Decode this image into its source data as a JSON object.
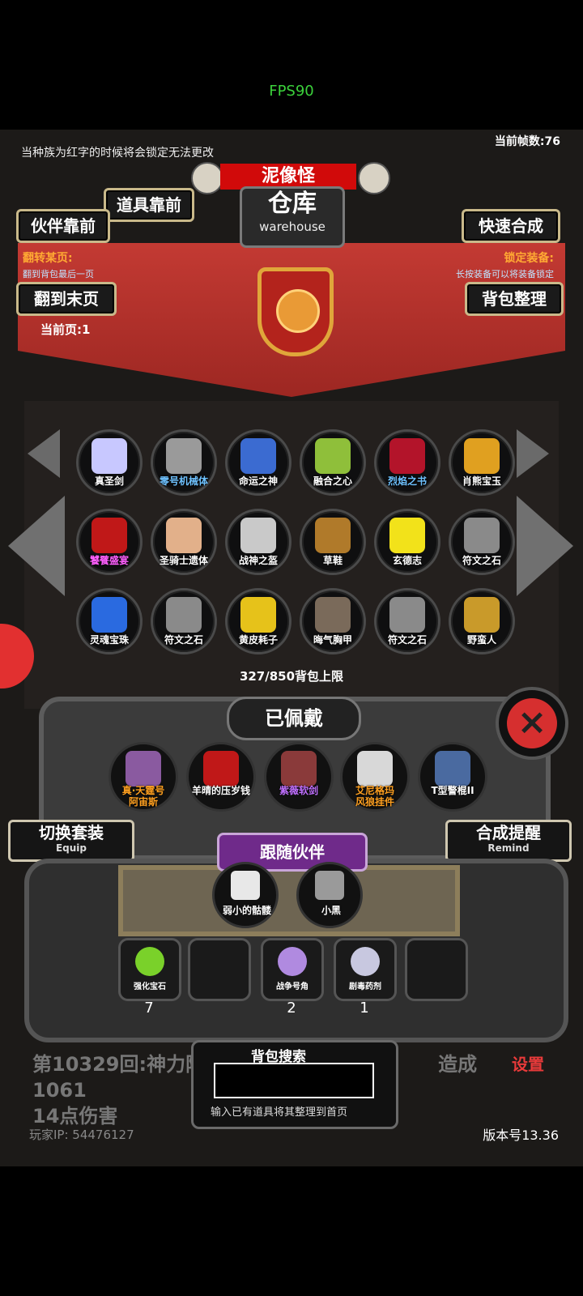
{
  "system": {
    "fps": "FPS90"
  },
  "header": {
    "notice": "当种族为红字的时候将会锁定无法更改",
    "current_fps": "当前帧数:76",
    "monster_name": "泥像怪",
    "warehouse_cn": "仓库",
    "warehouse_en": "warehouse"
  },
  "buttons": {
    "items_front": "道具靠前",
    "partner_front": "伙伴靠前",
    "quick_synth": "快速合成",
    "flip_last": "翻到末页",
    "bag_sort": "背包整理",
    "switch_set": "切换套装",
    "switch_set_en": "Equip",
    "synth_remind": "合成提醒",
    "synth_remind_en": "Remind",
    "settings": "设置"
  },
  "info": {
    "flip_title": "翻转某页:",
    "flip_desc": "翻到背包最后一页",
    "lock_title": "锁定装备:",
    "lock_desc": "长按装备可以将装备锁定",
    "current_page": "当前页:1",
    "capacity": "327/850背包上限"
  },
  "bag_items": [
    {
      "label": "真圣剑",
      "color": "#ffffff",
      "icon": "#c8c8ff"
    },
    {
      "label": "零号机械体",
      "color": "#6fc2ff",
      "icon": "#9a9a9a"
    },
    {
      "label": "命运之神",
      "color": "#ffffff",
      "icon": "#3b6bd1"
    },
    {
      "label": "融合之心",
      "color": "#ffffff",
      "icon": "#8fbf3a"
    },
    {
      "label": "烈焰之书",
      "color": "#6fc2ff",
      "icon": "#b3142a"
    },
    {
      "label": "肖熊宝玉",
      "color": "#ffffff",
      "icon": "#e0a020"
    },
    {
      "label": "饕餮盛宴",
      "color": "#ff60ff",
      "icon": "#c01818"
    },
    {
      "label": "圣骑士遗体",
      "color": "#ffffff",
      "icon": "#e2b08a"
    },
    {
      "label": "战神之盔",
      "color": "#ffffff",
      "icon": "#c9c9c9"
    },
    {
      "label": "草鞋",
      "color": "#ffffff",
      "icon": "#b07a2a"
    },
    {
      "label": "玄德志",
      "color": "#ffffff",
      "icon": "#f2e21a"
    },
    {
      "label": "符文之石",
      "color": "#ffffff",
      "icon": "#8a8a8a"
    },
    {
      "label": "灵魂宝珠",
      "color": "#ffffff",
      "icon": "#2a6ae0"
    },
    {
      "label": "符文之石",
      "color": "#ffffff",
      "icon": "#8a8a8a"
    },
    {
      "label": "黄皮耗子",
      "color": "#ffffff",
      "icon": "#e6c21a"
    },
    {
      "label": "晦气胸甲",
      "color": "#ffffff",
      "icon": "#7a6a5a"
    },
    {
      "label": "符文之石",
      "color": "#ffffff",
      "icon": "#8a8a8a"
    },
    {
      "label": "野蛮人",
      "color": "#ffffff",
      "icon": "#c99a2a"
    }
  ],
  "equipped": {
    "title": "已佩戴",
    "items": [
      {
        "label": "真·天霆号\n阿宙斯",
        "color": "#ffa020",
        "icon": "#8a5aa0"
      },
      {
        "label": "羊晴的压岁钱",
        "color": "#ffffff",
        "icon": "#c01818"
      },
      {
        "label": "紫薇软剑",
        "color": "#c070ff",
        "icon": "#8a3a3a"
      },
      {
        "label": "艾尼格玛\n风狼挂件",
        "color": "#ffa020",
        "icon": "#d8d8d8"
      },
      {
        "label": "T型警棍II",
        "color": "#ffffff",
        "icon": "#4a6aa0"
      }
    ]
  },
  "follow": {
    "title": "跟随伙伴",
    "companions": [
      {
        "label": "弱小的骷髅",
        "icon": "#e8e8e8"
      },
      {
        "label": "小黑",
        "icon": "#9a9a9a"
      }
    ]
  },
  "bag_bar": [
    {
      "label": "强化宝石",
      "count": "7",
      "icon": "#7ad12a"
    },
    {
      "label": "",
      "count": "",
      "icon": ""
    },
    {
      "label": "战争号角",
      "count": "2",
      "icon": "#b08ae0"
    },
    {
      "label": "剧毒药剂",
      "count": "1",
      "icon": "#c8c8e0"
    },
    {
      "label": "",
      "count": "",
      "icon": ""
    }
  ],
  "battle_log": "第10329回:神力附　　　　　　　　　　　　造成1061\n14点伤害",
  "search": {
    "title": "背包搜索",
    "hint": "输入已有道具将其整理到首页",
    "value": ""
  },
  "footer": {
    "player_ip": "玩家IP:  54476127",
    "version": "版本号13.36"
  }
}
